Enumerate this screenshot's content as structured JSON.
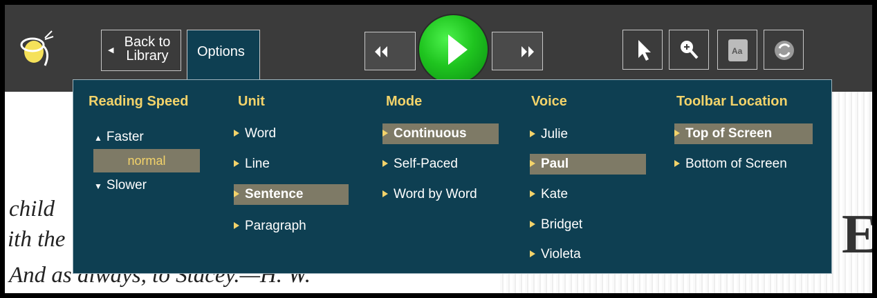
{
  "toolbar": {
    "back_label_line1": "Back to",
    "back_label_line2": "Library",
    "options_tab": "Options",
    "icons": [
      "firefly-logo-icon",
      "rewind-icon",
      "play-icon",
      "fast-forward-icon",
      "pointer-icon",
      "zoom-in-icon",
      "dictionary-icon",
      "refresh-icon"
    ]
  },
  "options": {
    "reading_speed": {
      "heading": "Reading Speed",
      "faster": "Faster",
      "current": "normal",
      "slower": "Slower"
    },
    "unit": {
      "heading": "Unit",
      "items": [
        "Word",
        "Line",
        "Sentence",
        "Paragraph"
      ],
      "selected": "Sentence"
    },
    "mode": {
      "heading": "Mode",
      "items": [
        "Continuous",
        "Self-Paced",
        "Word by Word"
      ],
      "selected": "Continuous"
    },
    "voice": {
      "heading": "Voice",
      "items": [
        "Julie",
        "Paul",
        "Kate",
        "Bridget",
        "Violeta"
      ],
      "selected": "Paul"
    },
    "toolbar_location": {
      "heading": "Toolbar Location",
      "items": [
        "Top of Screen",
        "Bottom of Screen"
      ],
      "selected": "Top of Screen"
    }
  },
  "page": {
    "line1": "child",
    "line2": "ith the",
    "line3": "And as always, to Stacey.—H. W.",
    "big_letter": "E"
  },
  "colors": {
    "toolbar": "#3b3b3b",
    "panel": "#0e3f52",
    "heading": "#f3d36a",
    "selected_bg": "#7e7a66",
    "play": "#1fc41f"
  }
}
